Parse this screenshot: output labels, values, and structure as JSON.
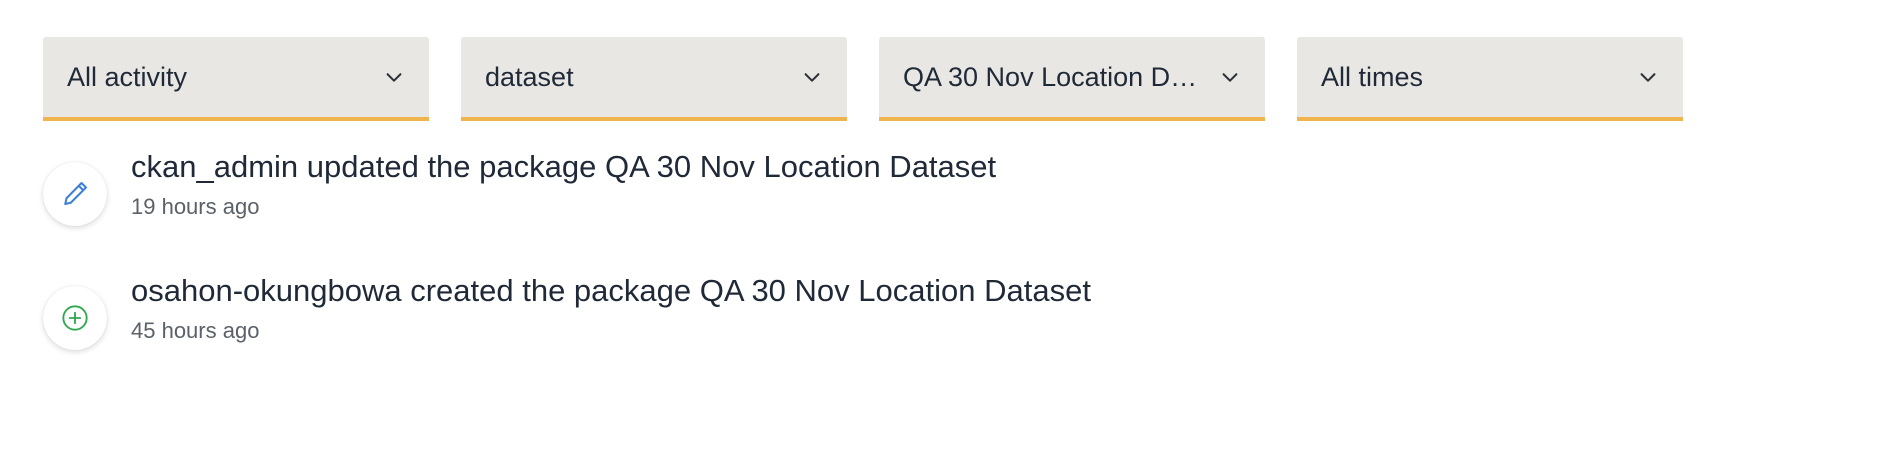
{
  "filters": [
    {
      "label": "All activity",
      "icon": "chevron-down-icon"
    },
    {
      "label": "dataset",
      "icon": "chevron-down-icon"
    },
    {
      "label": "QA 30 Nov Location Da...",
      "icon": "chevron-down-icon"
    },
    {
      "label": "All times",
      "icon": "chevron-down-icon"
    }
  ],
  "activities": [
    {
      "text": "ckan_admin updated the package QA 30 Nov Location Dataset",
      "time": "19 hours ago",
      "icon": "pencil-icon",
      "icon_color": "#3b7fd6"
    },
    {
      "text": "osahon-okungbowa created the package QA 30 Nov Location Dataset",
      "time": "45 hours ago",
      "icon": "plus-circle-icon",
      "icon_color": "#2fa84f"
    }
  ],
  "colors": {
    "filter_background": "#e8e7e3",
    "filter_accent": "#f0b44c"
  }
}
